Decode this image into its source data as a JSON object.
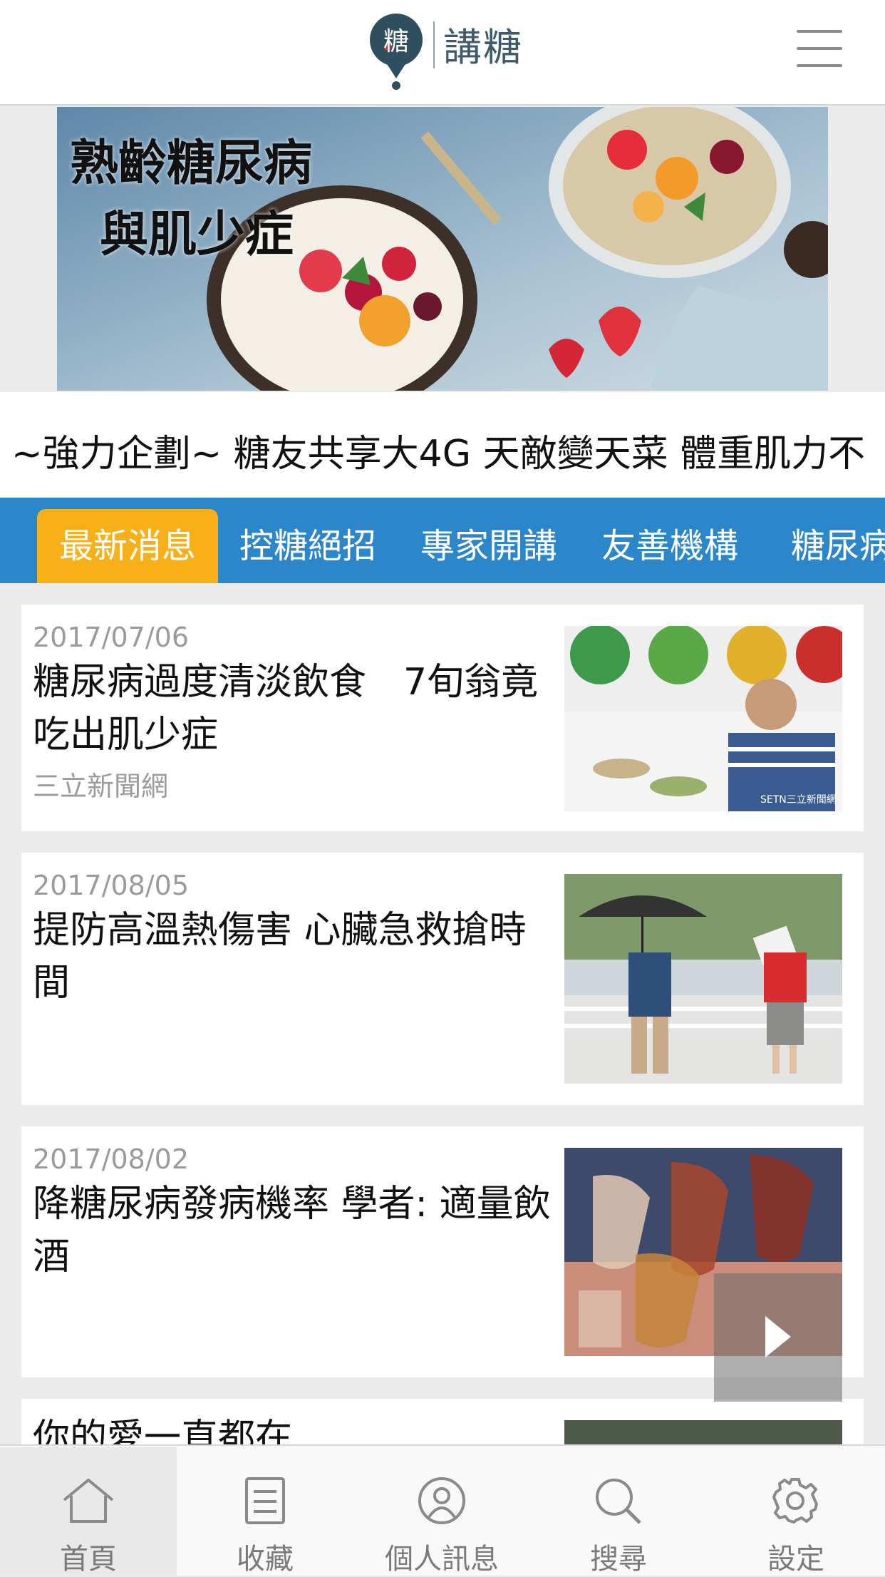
{
  "header": {
    "logo_char": "糖",
    "logo_text": "講糖",
    "menu_icon": "hamburger-menu-icon"
  },
  "banner": {
    "line1": "熟齡糖尿病",
    "line2": "與肌少症"
  },
  "marquee": {
    "text": "~強力企劃~ 糖友共享大4G 天敵變天菜 體重肌力不"
  },
  "tabs": [
    "最新消息",
    "控糖絕招",
    "專家開講",
    "友善機構",
    "糖尿病"
  ],
  "articles": [
    {
      "date": "2017/07/06",
      "title": "糖尿病過度清淡飲食　7旬翁竟吃出肌少症",
      "source": "三立新聞網",
      "thumb_label": "SETN三立新聞網"
    },
    {
      "date": "2017/08/05",
      "title": "提防高溫熱傷害 心臟急救搶時間",
      "source": ""
    },
    {
      "date": "2017/08/02",
      "title": "降糖尿病發病機率 學者: 適量飲酒",
      "source": ""
    },
    {
      "date": "",
      "title": "你的愛一直都在",
      "source": ""
    }
  ],
  "tabbar": [
    {
      "label": "首頁",
      "icon": "home-icon"
    },
    {
      "label": "收藏",
      "icon": "bookmark-list-icon"
    },
    {
      "label": "個人訊息",
      "icon": "user-icon"
    },
    {
      "label": "搜尋",
      "icon": "search-icon"
    },
    {
      "label": "設定",
      "icon": "gear-icon"
    }
  ],
  "colors": {
    "tab_bar_blue": "#2b87c9",
    "active_tab_orange": "#f8b019",
    "logo_teal": "#3f5b6b"
  }
}
